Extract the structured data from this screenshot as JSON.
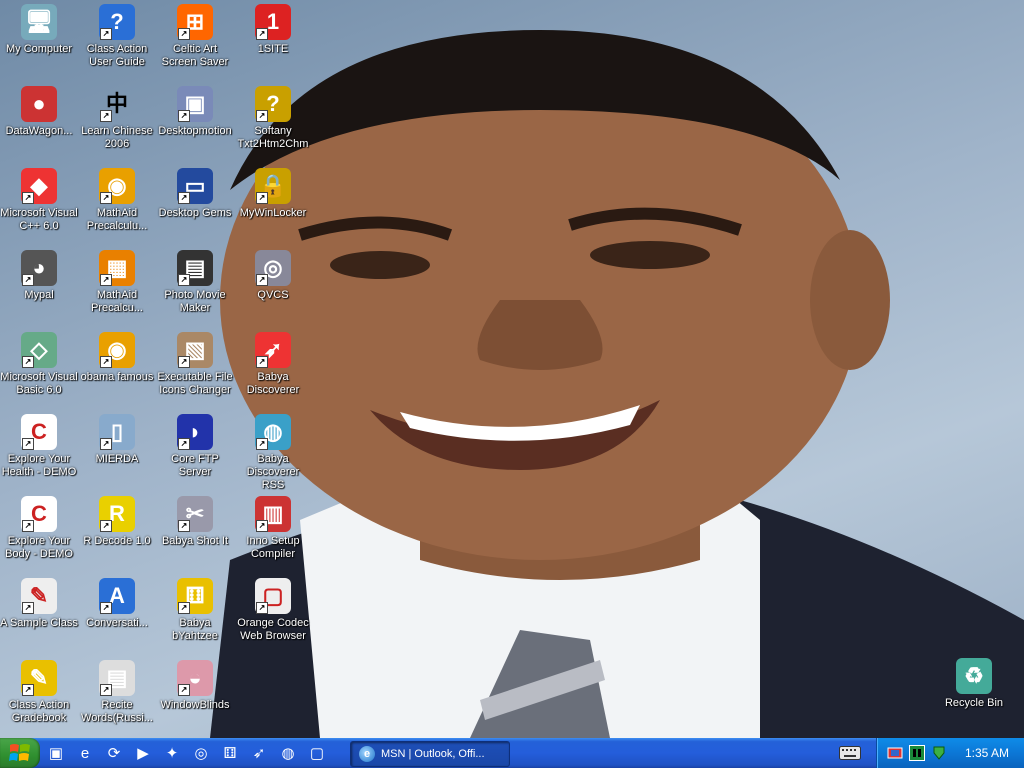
{
  "desktop": {
    "icons": [
      {
        "label": "My Computer",
        "icon": "my-computer-icon"
      },
      {
        "label": "Class Action\nUser Guide",
        "icon": "help-icon"
      },
      {
        "label": "Celtic Art\nScreen Saver",
        "icon": "windows-flag-icon"
      },
      {
        "label": "1SITE",
        "icon": "1site-icon"
      },
      {
        "label": "DataWagon...",
        "icon": "datawagon-icon"
      },
      {
        "label": "Learn Chinese\n2006",
        "icon": "chinese-character-icon"
      },
      {
        "label": "Desktopmotion",
        "icon": "desktopmotion-icon"
      },
      {
        "label": "Softany\nTxt2Htm2Chm",
        "icon": "softany-icon"
      },
      {
        "label": "Microsoft Visual\nC++ 6.0",
        "icon": "visual-cpp-icon"
      },
      {
        "label": "MathAid\nPrecalculu...",
        "icon": "chrome-style-icon"
      },
      {
        "label": "Desktop Gems",
        "icon": "monitor-icon"
      },
      {
        "label": "MyWinLocker",
        "icon": "padlock-icon"
      },
      {
        "label": "Mypal",
        "icon": "raccoon-icon"
      },
      {
        "label": "MathAid\nPrecalcu...",
        "icon": "mathaid-blocks-icon"
      },
      {
        "label": "Photo Movie\nMaker",
        "icon": "clapperboard-icon"
      },
      {
        "label": "QVCS",
        "icon": "camera-icon"
      },
      {
        "label": "Microsoft Visual\nBasic 6.0",
        "icon": "visual-basic-icon"
      },
      {
        "label": "obama famous",
        "icon": "chrome-style-icon"
      },
      {
        "label": "Executable File\nIcons Changer",
        "icon": "icons-changer-icon"
      },
      {
        "label": "Babya\nDiscoverer",
        "icon": "rocket-icon"
      },
      {
        "label": "Explore Your\nHealth - DEMO",
        "icon": "explore-c-icon"
      },
      {
        "label": "MIERDA",
        "icon": "document-icon"
      },
      {
        "label": "Core FTP\nServer",
        "icon": "ftp-icon"
      },
      {
        "label": "Babya\nDiscoverer RSS",
        "icon": "rss-globe-icon"
      },
      {
        "label": "Explore Your\nBody - DEMO",
        "icon": "explore-c-icon"
      },
      {
        "label": "R Decode 1.0",
        "icon": "r-decode-icon"
      },
      {
        "label": "Babya Shot It",
        "icon": "screenshot-icon"
      },
      {
        "label": "Inno Setup\nCompiler",
        "icon": "installer-icon"
      },
      {
        "label": "A Sample Class",
        "icon": "sample-class-icon"
      },
      {
        "label": "Conversati...",
        "icon": "conversation-icon"
      },
      {
        "label": "Babya\nbYahtzee",
        "icon": "dice-icon"
      },
      {
        "label": "Orange Codec\nWeb Browser",
        "icon": "browser-page-icon"
      },
      {
        "label": "Class Action\nGradebook",
        "icon": "gradebook-icon"
      },
      {
        "label": "Recite\nWords(Russi...",
        "icon": "book-icon"
      },
      {
        "label": "WindowBlinds",
        "icon": "palette-icon"
      },
      {
        "label": "Recycle Bin",
        "icon": "recycle-bin-icon"
      }
    ]
  },
  "taskbar": {
    "start_icon": "windows-logo-icon",
    "quick_launch": [
      "computer-icon",
      "internet-explorer-icon",
      "media-refresh-icon",
      "media-player-icon",
      "tools-icon",
      "camera-icon",
      "dice-icon",
      "rocket-icon",
      "globe-icon",
      "window-icon"
    ],
    "tasks": [
      {
        "label": "MSN | Outlook, Offi...",
        "icon": "internet-explorer-icon"
      }
    ],
    "language_icon": "keyboard-icon",
    "tray_icons": [
      "network-icon",
      "pause-icon",
      "safely-remove-icon"
    ],
    "clock": "1:35 AM"
  },
  "colors": {
    "taskbar": "#245edb",
    "tray": "#0c77d6",
    "start": "#2f8f2f"
  }
}
